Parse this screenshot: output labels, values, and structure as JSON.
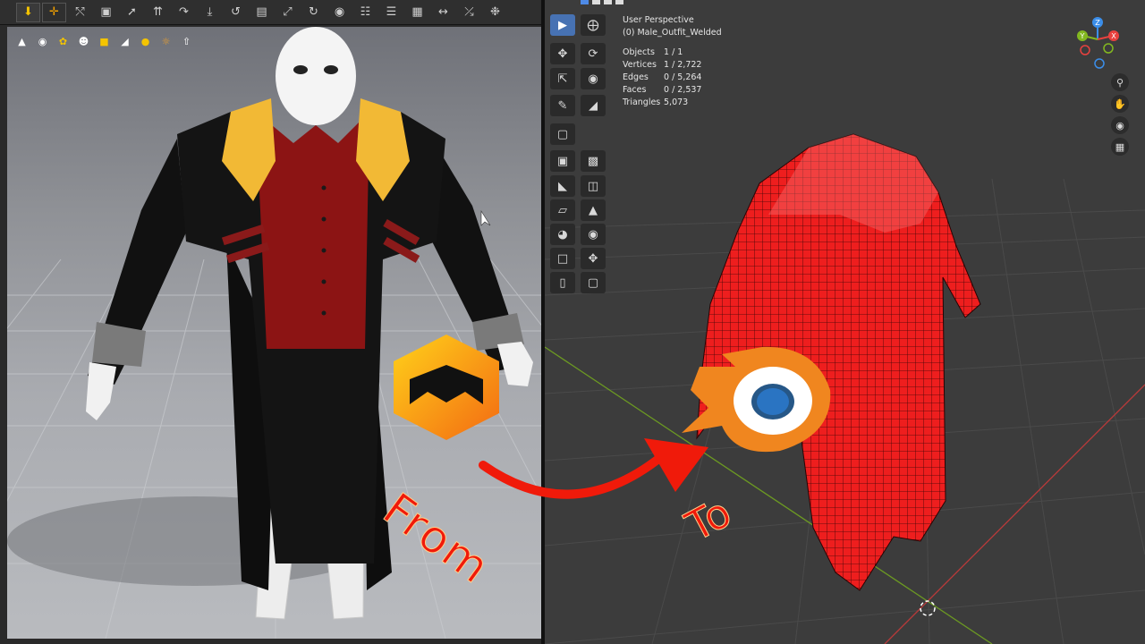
{
  "marvelous": {
    "main_tools": [
      "arrow-down-icon",
      "move-icon",
      "edit-pattern-icon",
      "transform-icon",
      "segment-icon",
      "fold-icon",
      "tack-icon",
      "pin-icon",
      "sew-icon",
      "free-sew-icon",
      "fabric-icon",
      "texture-icon",
      "button-icon",
      "zipper-icon",
      "topstitch-icon",
      "measure-icon",
      "avatar-icon"
    ],
    "sub_tools": [
      "select-mesh-icon",
      "garment-icon",
      "fabric-color-icon",
      "avatar-display-icon",
      "pattern-icon",
      "lighting-icon",
      "texture-ball-icon",
      "sun-icon",
      "export-icon"
    ]
  },
  "blender": {
    "view_name": "User Perspective",
    "object_name": "(0) Male_Outfit_Welded",
    "stats": [
      {
        "key": "Objects",
        "value": "1 / 1"
      },
      {
        "key": "Vertices",
        "value": "1 / 2,722"
      },
      {
        "key": "Edges",
        "value": "0 / 5,264"
      },
      {
        "key": "Faces",
        "value": "0 / 2,537"
      },
      {
        "key": "Triangles",
        "value": "5,073"
      }
    ],
    "gizmo": {
      "x": "X",
      "y": "Y",
      "z": "Z"
    },
    "colors": {
      "accent": "#4772b3",
      "x_axis": "#e8413e",
      "y_axis": "#83b820",
      "z_axis": "#3b8ee9"
    }
  },
  "overlay": {
    "from_text": "From",
    "to_text": "To",
    "arrow_color": "#f01a0a"
  }
}
